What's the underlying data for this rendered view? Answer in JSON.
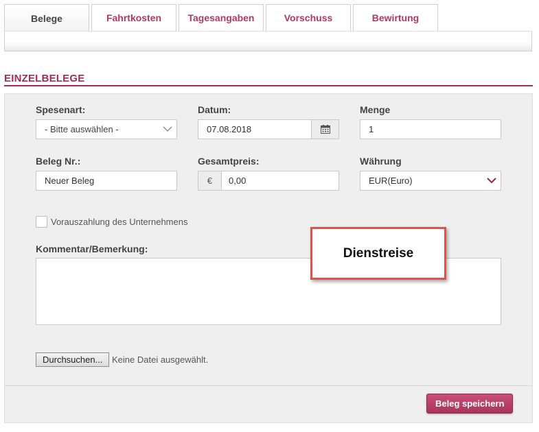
{
  "tabs": [
    {
      "label": "Belege",
      "active": true
    },
    {
      "label": "Fahrtkosten",
      "active": false
    },
    {
      "label": "Tagesangaben",
      "active": false
    },
    {
      "label": "Vorschuss",
      "active": false
    },
    {
      "label": "Bewirtung",
      "active": false
    }
  ],
  "section": {
    "title": "EINZELBELEGE"
  },
  "form": {
    "spesenart": {
      "label": "Spesenart:",
      "value": "- Bitte auswählen -"
    },
    "datum": {
      "label": "Datum:",
      "value": "07.08.2018"
    },
    "menge": {
      "label": "Menge",
      "value": "1"
    },
    "beleg_nr": {
      "label": "Beleg Nr.:",
      "value": "Neuer Beleg"
    },
    "gesamtpreis": {
      "label": "Gesamtpreis:",
      "currency_symbol": "€",
      "value": "0,00"
    },
    "waehrung": {
      "label": "Währung",
      "value": "EUR(Euro)"
    },
    "vorauszahlung": {
      "label": "Vorauszahlung des Unternehmens",
      "checked": false
    },
    "kommentar": {
      "label": "Kommentar/Bemerkung:",
      "value": ""
    },
    "file": {
      "button_label": "Durchsuchen...",
      "status": "Keine Datei ausgewählt."
    },
    "save_label": "Beleg speichern"
  },
  "callout": {
    "text": "Dienstreise"
  },
  "colors": {
    "accent": "#a52a57",
    "callout_border": "#e0524d"
  },
  "icons": {
    "calendar": "calendar-icon",
    "chevron": "chevron-down-icon"
  }
}
